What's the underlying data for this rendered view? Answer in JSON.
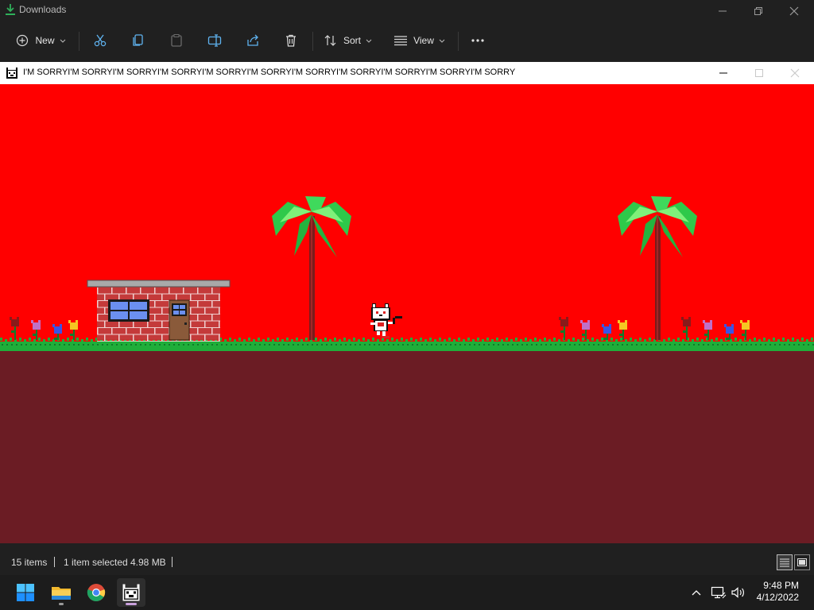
{
  "explorer": {
    "title": "Downloads",
    "toolbar": {
      "new_label": "New",
      "sort_label": "Sort",
      "view_label": "View"
    }
  },
  "game_window": {
    "title": "I'M SORRYI'M SORRYI'M SORRYI'M SORRYI'M SORRYI'M SORRYI'M SORRYI'M SORRYI'M SORRYI'M SORRYI'M SORRY",
    "sky_color": "#ff0000",
    "ground_color": "#6b1c24",
    "grass_color": "#1fae3a"
  },
  "statusbar": {
    "items_count": "15 items",
    "selection": "1 item selected",
    "size": "4.98 MB"
  },
  "taskbar": {
    "time": "9:48 PM",
    "date": "4/12/2022",
    "apps": [
      "start-icon",
      "file-explorer-icon",
      "chrome-icon",
      "cat-game-icon"
    ]
  }
}
